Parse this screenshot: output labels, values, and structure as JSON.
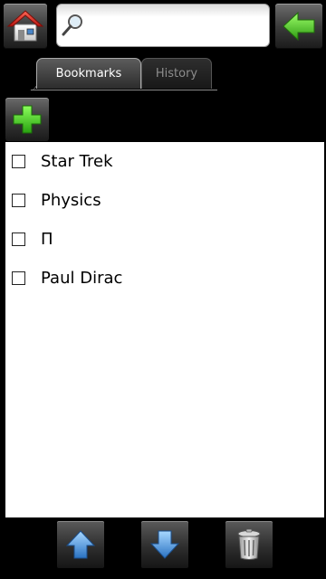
{
  "topbar": {
    "home_icon": "home-icon",
    "search": {
      "icon": "search-icon",
      "value": "",
      "placeholder": ""
    },
    "back_icon": "back-arrow-icon"
  },
  "tabs": [
    {
      "label": "Bookmarks",
      "active": true
    },
    {
      "label": "History",
      "active": false
    }
  ],
  "toolbar": {
    "add_icon": "plus-icon"
  },
  "bookmarks": [
    {
      "label": "Star Trek",
      "checked": false
    },
    {
      "label": "Physics",
      "checked": false
    },
    {
      "label": "Π",
      "checked": false
    },
    {
      "label": "Paul Dirac",
      "checked": false
    }
  ],
  "bottom_bar": {
    "move_up_icon": "arrow-up-icon",
    "move_down_icon": "arrow-down-icon",
    "delete_icon": "trash-icon"
  },
  "colors": {
    "accent_green": "#3fbf1f",
    "home_red": "#c8261e",
    "arrow_blue": "#3c8fd8"
  }
}
